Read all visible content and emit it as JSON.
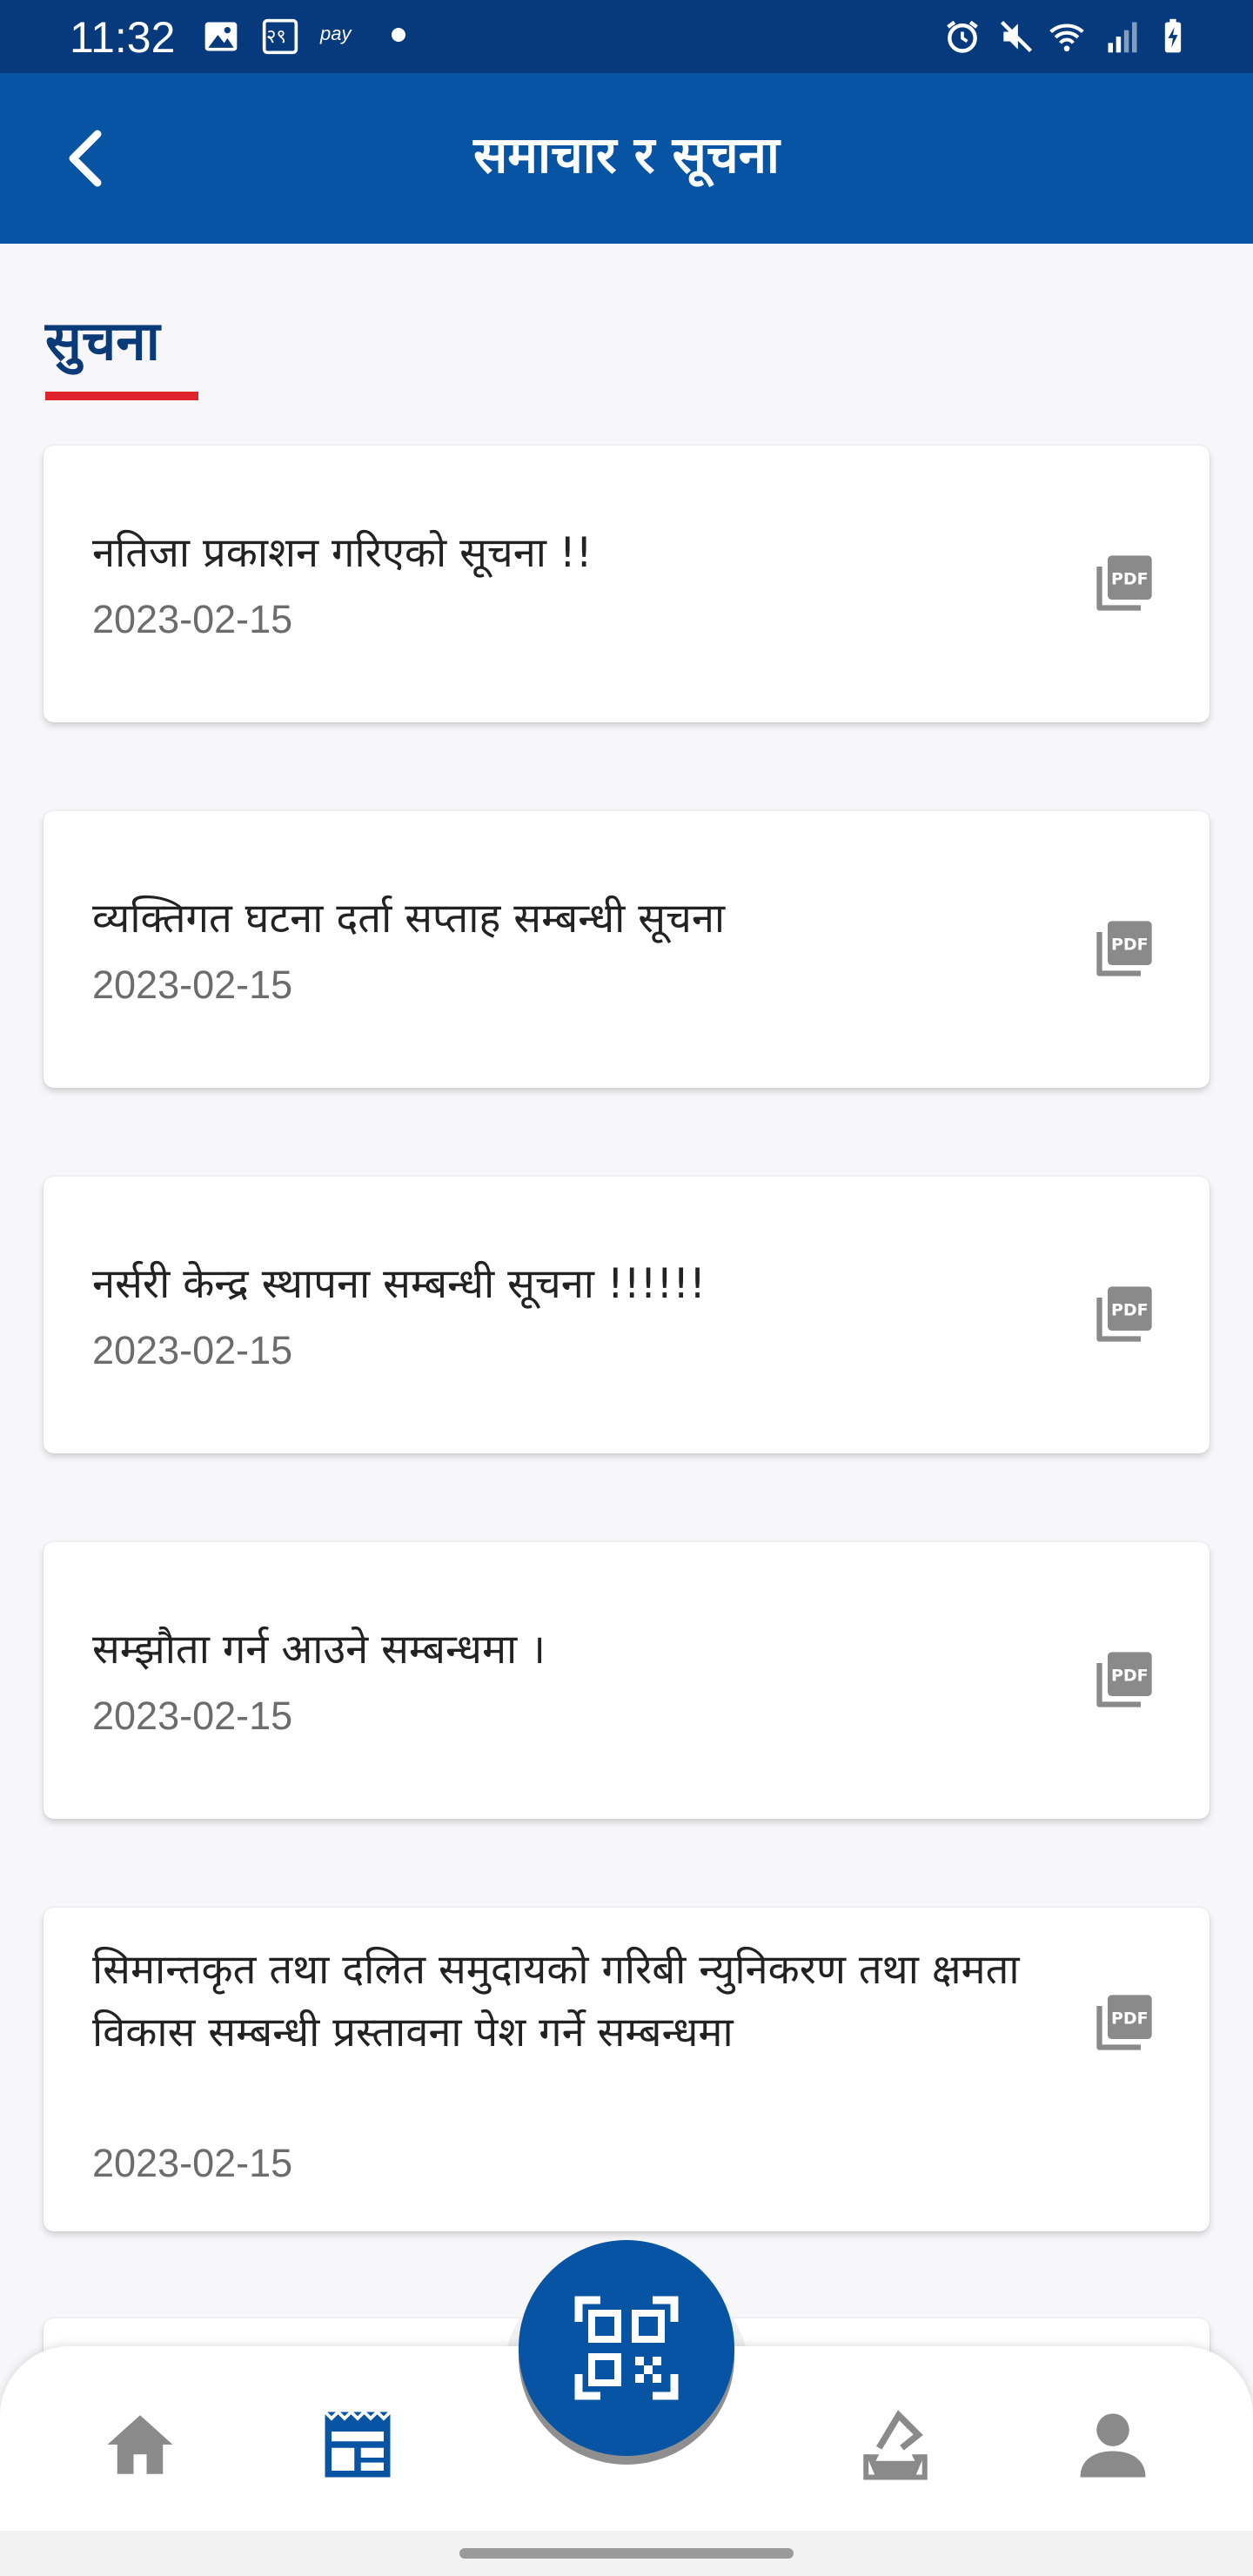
{
  "status_bar": {
    "time": "11:32",
    "pay_label": "pay",
    "badge": "२९",
    "icons": [
      "image-icon",
      "calendar-icon",
      "pay-icon",
      "dot-icon",
      "alarm-icon",
      "mute-icon",
      "wifi-icon",
      "signal-icon",
      "battery-icon"
    ]
  },
  "app_bar": {
    "title": "समाचार र सूचना",
    "back_icon": "chevron-left-icon"
  },
  "section": {
    "title": "सुचना",
    "accent_color": "#e0242b"
  },
  "notices": [
    {
      "title": "नतिजा प्रकाशन गरिएको सूचना !!",
      "date": "2023-02-15",
      "icon": "pdf-icon"
    },
    {
      "title": "व्यक्तिगत घटना दर्ता सप्ताह सम्बन्धी सूचना",
      "date": "2023-02-15",
      "icon": "pdf-icon"
    },
    {
      "title": "नर्सरी केन्द्र स्थापना सम्बन्धी सूचना !!!!!!",
      "date": "2023-02-15",
      "icon": "pdf-icon"
    },
    {
      "title": "सम्झौता गर्न आउने सम्बन्धमा ।",
      "date": "2023-02-15",
      "icon": "pdf-icon"
    },
    {
      "title": "सिमान्तकृत तथा दलित समुदायको गरिबी न्युनिकरण तथा क्षमता विकास सम्बन्धी प्रस्तावना पेश गर्ने सम्बन्धमा",
      "date": "2023-02-15",
      "icon": "pdf-icon"
    }
  ],
  "bottom_nav": {
    "items": [
      {
        "icon": "home-icon",
        "active": false
      },
      {
        "icon": "news-icon",
        "active": true
      },
      {
        "icon": "qr-scan-icon",
        "active": false
      },
      {
        "icon": "vote-icon",
        "active": false
      },
      {
        "icon": "profile-icon",
        "active": false
      }
    ]
  },
  "colors": {
    "status_bar": "#063a7c",
    "app_bar": "#0753a4",
    "section_title": "#0b3a78",
    "icon_gray": "#8a8a8a",
    "nav_active": "#0753a4"
  }
}
